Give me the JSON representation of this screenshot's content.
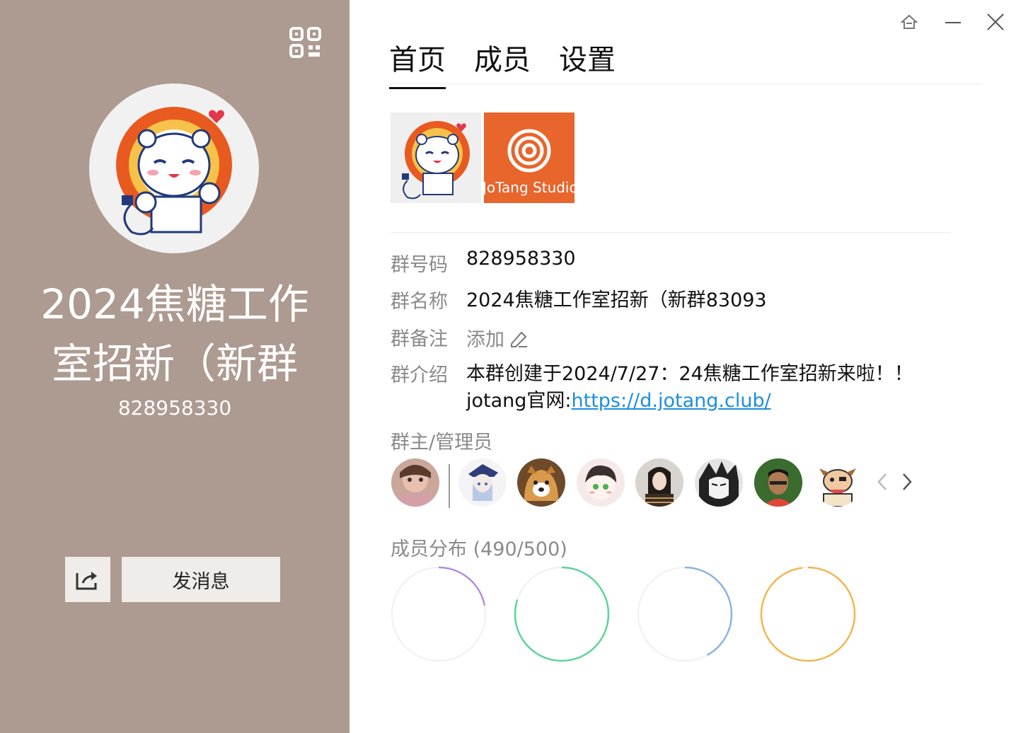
{
  "sidebar": {
    "title": "2024焦糖工作室招新（新群",
    "group_id": "828958330",
    "send_message": "发消息"
  },
  "tabs": [
    {
      "label": "首页",
      "active": true
    },
    {
      "label": "成员",
      "active": false
    },
    {
      "label": "设置",
      "active": false
    }
  ],
  "album": {
    "studio_text": "JoTang Studio"
  },
  "info": {
    "group_number_label": "群号码",
    "group_number": "828958330",
    "group_name_label": "群名称",
    "group_name": "2024焦糖工作室招新（新群83093",
    "group_note_label": "群备注",
    "group_note_action": "添加",
    "group_intro_label": "群介绍",
    "group_intro_line1": "本群创建于2024/7/27：24焦糖工作室招新来啦！！",
    "group_intro_line2_prefix": "jotang官网:",
    "group_intro_link": "https://d.jotang.club/"
  },
  "admins": {
    "title": "群主/管理员"
  },
  "distribution": {
    "title": "成员分布 (490/500)",
    "rings": [
      {
        "color": "#b28be0",
        "fraction": 0.22
      },
      {
        "color": "#5fd39a",
        "fraction": 0.8
      },
      {
        "color": "#8ab3e6",
        "fraction": 0.42
      },
      {
        "color": "#f2b650",
        "fraction": 0.98
      }
    ]
  },
  "colors": {
    "sidebar_bg": "#ad9a90",
    "link": "#1a8fe0",
    "orange": "#e8652c"
  }
}
